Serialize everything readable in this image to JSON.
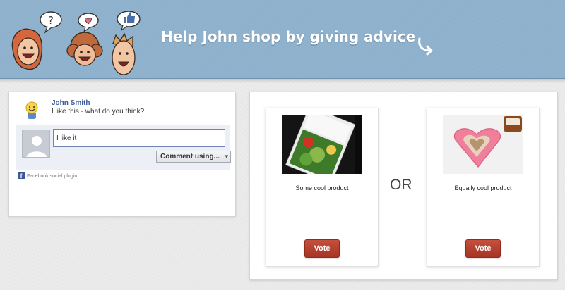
{
  "header": {
    "title": "Help John shop by giving advice",
    "icons": [
      "question-bubble-icon",
      "heart-bubble-icon",
      "thumbs-up-bubble-icon",
      "curved-arrow-icon"
    ],
    "background_color": "#8db0cc"
  },
  "facebook": {
    "post": {
      "author": "John Smith",
      "text": "I like this - what do you think?"
    },
    "comment_input": {
      "value": "I like it"
    },
    "comment_button_label": "Comment using...",
    "plugin_label": "Facebook social plugin",
    "brand_color": "#3b5998"
  },
  "vote": {
    "or_label": "OR",
    "options": [
      {
        "name": "Some cool product",
        "button_label": "Vote"
      },
      {
        "name": "Equally cool product",
        "button_label": "Vote"
      }
    ],
    "button_color": "#b03e2d"
  }
}
